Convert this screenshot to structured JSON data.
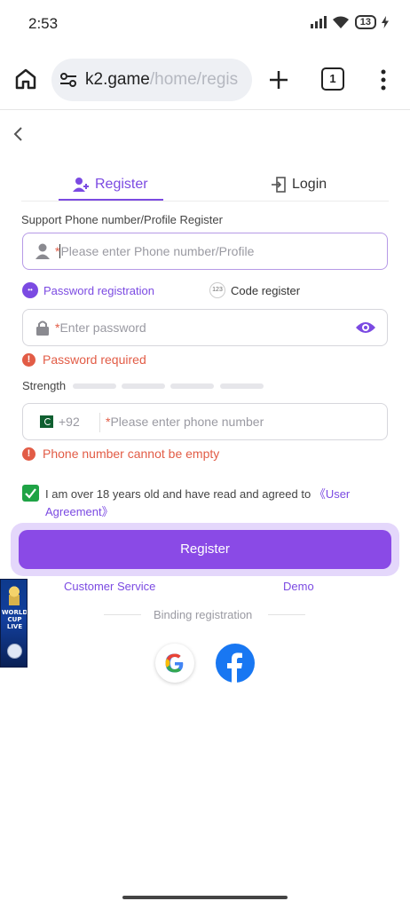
{
  "status_bar": {
    "time": "2:53",
    "battery": "13"
  },
  "browser": {
    "url_domain": "k2.game",
    "url_path": "/home/regis",
    "tab_count": "1"
  },
  "tabs": {
    "register": "Register",
    "login": "Login"
  },
  "form": {
    "section_label": "Support Phone number/Profile Register",
    "phone_profile_placeholder": "Please enter Phone number/Profile",
    "password_registration": "Password registration",
    "code_register": "Code register",
    "code_badge": "123",
    "password_placeholder": "Enter password",
    "password_error": "Password required",
    "strength_label": "Strength",
    "country_code": "+92",
    "phone_placeholder": "Please enter phone number",
    "phone_error": "Phone number cannot be empty",
    "required_mark": "*",
    "agree_text": "I am over 18 years old and have read and agreed to ",
    "agree_link": "《User Agreement》",
    "register_button": "Register"
  },
  "links": {
    "customer_service": "Customer Service",
    "demo": "Demo"
  },
  "binding": {
    "label": "Binding registration"
  },
  "banner": {
    "text_line1": "WORLD",
    "text_line2": "CUP",
    "text_line3": "LIVE"
  },
  "colors": {
    "accent": "#8a4ae6",
    "error": "#e25c46",
    "checkbox": "#1fa345",
    "facebook": "#1877f2"
  },
  "icons": [
    "home-icon",
    "tune-icon",
    "plus-icon",
    "tabs-icon",
    "menu-icon",
    "back-icon",
    "add-user-icon",
    "login-icon",
    "user-icon",
    "lock-icon",
    "eye-icon",
    "alert-icon",
    "pakistan-flag-icon",
    "check-icon",
    "google-icon",
    "facebook-icon"
  ]
}
